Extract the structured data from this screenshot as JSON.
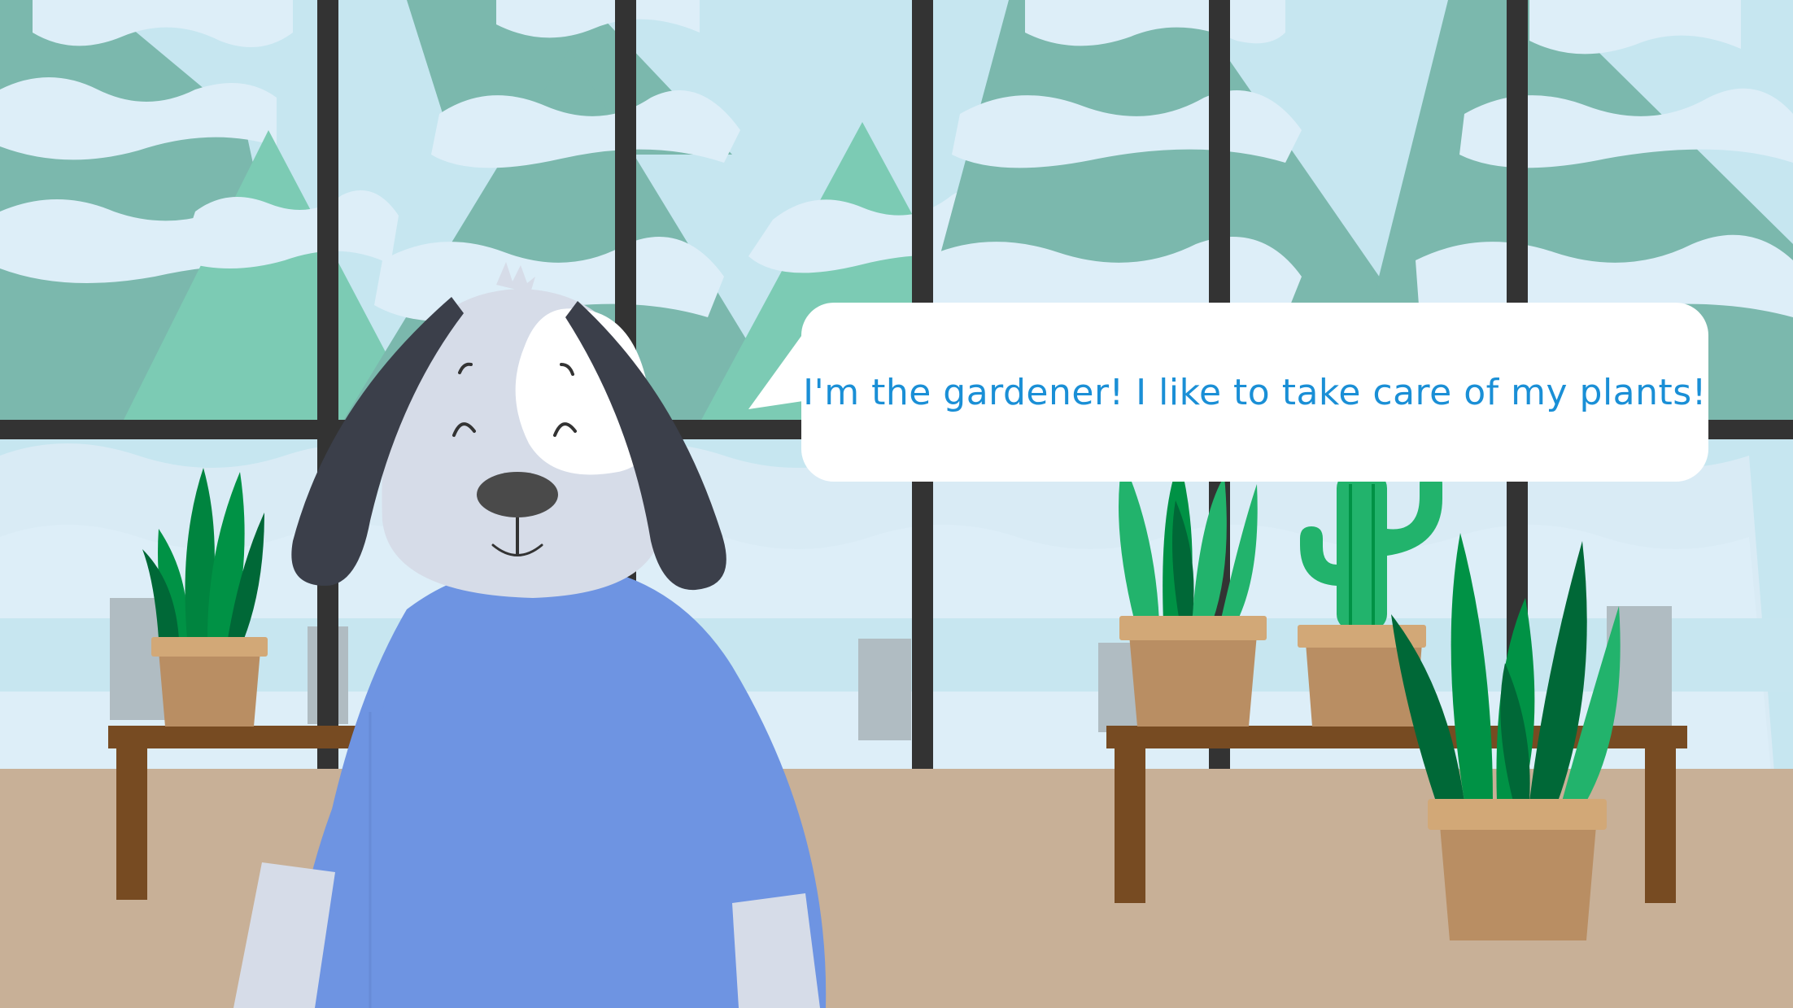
{
  "scene": {
    "character": "dog-gardener",
    "speech_bubble": {
      "text": "I'm the gardener! I like to take care of my plants!"
    }
  },
  "colors": {
    "sky": "#c6e6f0",
    "snow": "#ddeef8",
    "tree_dark": "#7bb8ad",
    "tree_light": "#7ccbb4",
    "window_frame": "#333333",
    "floor": "#c8b097",
    "table": "#774b22",
    "pot": "#b98e63",
    "pot_rim": "#d2a877",
    "leaf_dark": "#006837",
    "leaf_mid": "#009245",
    "leaf_light": "#22b36c",
    "dog_fur": "#d6dce8",
    "dog_ear": "#3b3f4a",
    "dog_shirt": "#6e94e2",
    "speech_text": "#1a8fd6"
  }
}
